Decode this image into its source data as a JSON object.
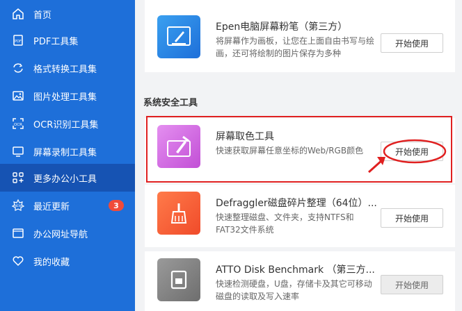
{
  "sidebar": {
    "items": [
      {
        "label": "首页",
        "icon": "home-icon"
      },
      {
        "label": "PDF工具集",
        "icon": "pdf-icon"
      },
      {
        "label": "格式转换工具集",
        "icon": "convert-icon"
      },
      {
        "label": "图片处理工具集",
        "icon": "image-icon"
      },
      {
        "label": "OCR识别工具集",
        "icon": "ocr-icon"
      },
      {
        "label": "屏幕录制工具集",
        "icon": "screen-record-icon"
      },
      {
        "label": "更多办公小工具",
        "icon": "grid-icon",
        "active": true
      },
      {
        "label": "最近更新",
        "icon": "new-icon",
        "badge": "3"
      },
      {
        "label": "办公网址导航",
        "icon": "bookmark-icon"
      },
      {
        "label": "我的收藏",
        "icon": "heart-icon"
      }
    ]
  },
  "main": {
    "section_title": "系统安全工具",
    "cards": [
      {
        "title": "Epen电脑屏幕粉笔（第三方）",
        "desc": "将屏幕作为画板，让您在上面自由书写与绘画，还可将绘制的图片保存为多种",
        "button": "开始使用",
        "icon": "pen-icon"
      },
      {
        "title": "屏幕取色工具",
        "desc": "快速获取屏幕任意坐标的Web/RGB颜色",
        "button": "开始使用",
        "icon": "color-picker-icon"
      },
      {
        "title": "Defraggler磁盘碎片整理（64位）...",
        "desc": "快速整理磁盘、文件夹，支持NTFS和FAT32文件系统",
        "button": "开始使用",
        "icon": "broom-icon"
      },
      {
        "title": "ATTO Disk Benchmark （第三方...",
        "desc": "快速检测硬盘，U盘，存储卡及其它可移动磁盘的读取及写入速率",
        "button": "开始使用",
        "icon": "disk-icon"
      }
    ]
  },
  "colors": {
    "sidebar_bg": "#1e6fd9",
    "sidebar_active": "#1653b3",
    "highlight": "#e02020",
    "badge": "#f04b3a"
  }
}
